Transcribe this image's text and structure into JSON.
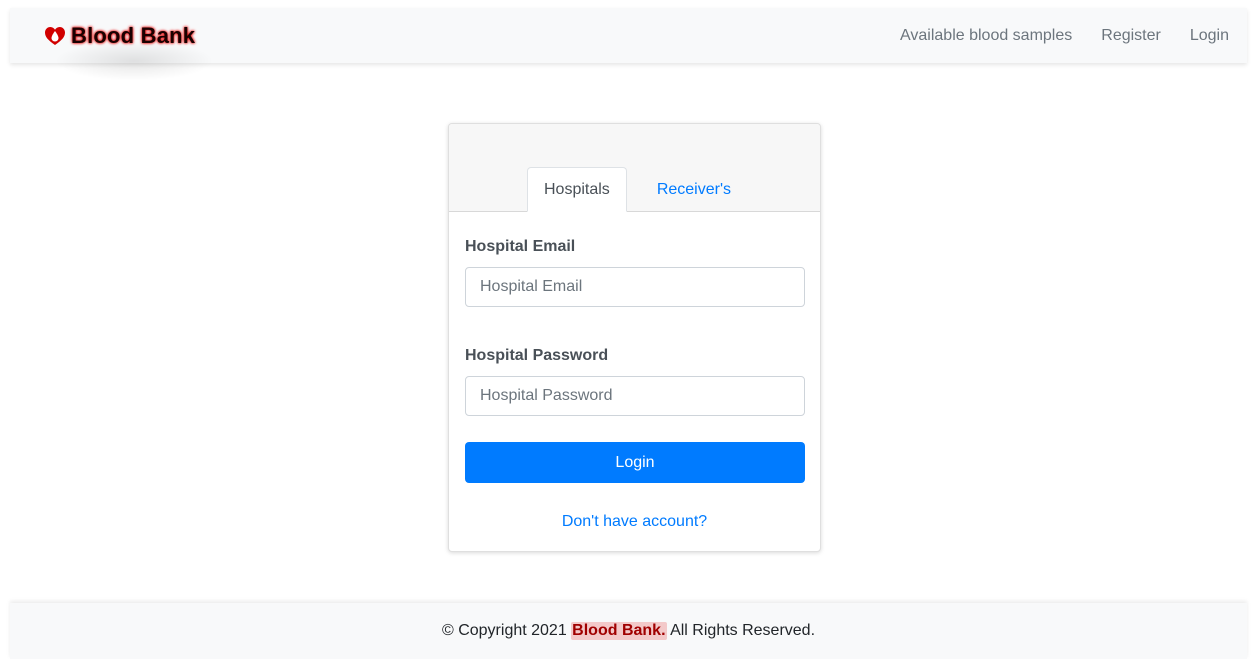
{
  "navbar": {
    "brand_icon": "heart-drop-icon",
    "brand": "Blood Bank",
    "links": [
      "Available blood samples",
      "Register",
      "Login"
    ]
  },
  "login_card": {
    "tabs": [
      "Hospitals",
      "Receiver's"
    ],
    "active_tab": "Hospitals",
    "email_label": "Hospital Email",
    "email_placeholder": "Hospital Email",
    "password_label": "Hospital Password",
    "password_placeholder": "Hospital Password",
    "login_button": "Login",
    "signup_link": "Don't have account?"
  },
  "footer": {
    "prefix": "© Copyright 2021 ",
    "brand": "Blood Bank.",
    "suffix": " All Rights Reserved."
  },
  "colors": {
    "primary": "#007bff",
    "brand_glow": "#e00000",
    "navbar_bg": "#f8f9fa"
  }
}
